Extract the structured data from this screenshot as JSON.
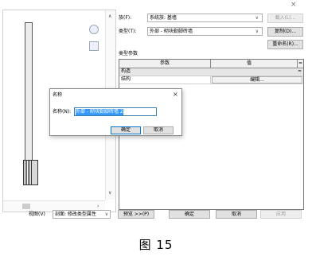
{
  "window": {
    "close_glyph": "×"
  },
  "type_props": {
    "family_label": "族(F):",
    "family_value": "系统族: 基墙",
    "type_label": "类型(T):",
    "type_value": "外部 - 砌块勒脚砖墙",
    "load_button": "载入(L)...",
    "duplicate_button": "复制(D)...",
    "rename_button": "重命名(R)...",
    "section_label": "类型参数",
    "grid_header_param": "参数",
    "grid_header_value": "值",
    "group_label": "构造",
    "group_toggle": "≈",
    "row_param": "结构",
    "edit_button": "编辑..."
  },
  "name_dialog": {
    "title": "名称",
    "close_glyph": "×",
    "field_label": "名称(N):",
    "field_value": "外部 - 砌块勒脚砖墙 2",
    "ok_button": "确定",
    "cancel_button": "取消"
  },
  "bottom": {
    "view_label": "视图(V)",
    "view_value": "剖面: 修改类型属性",
    "preview_button": "预览 >>(P)",
    "ok_button": "确定",
    "cancel_button": "取消",
    "apply_button": "应用"
  },
  "caption": "图 15"
}
